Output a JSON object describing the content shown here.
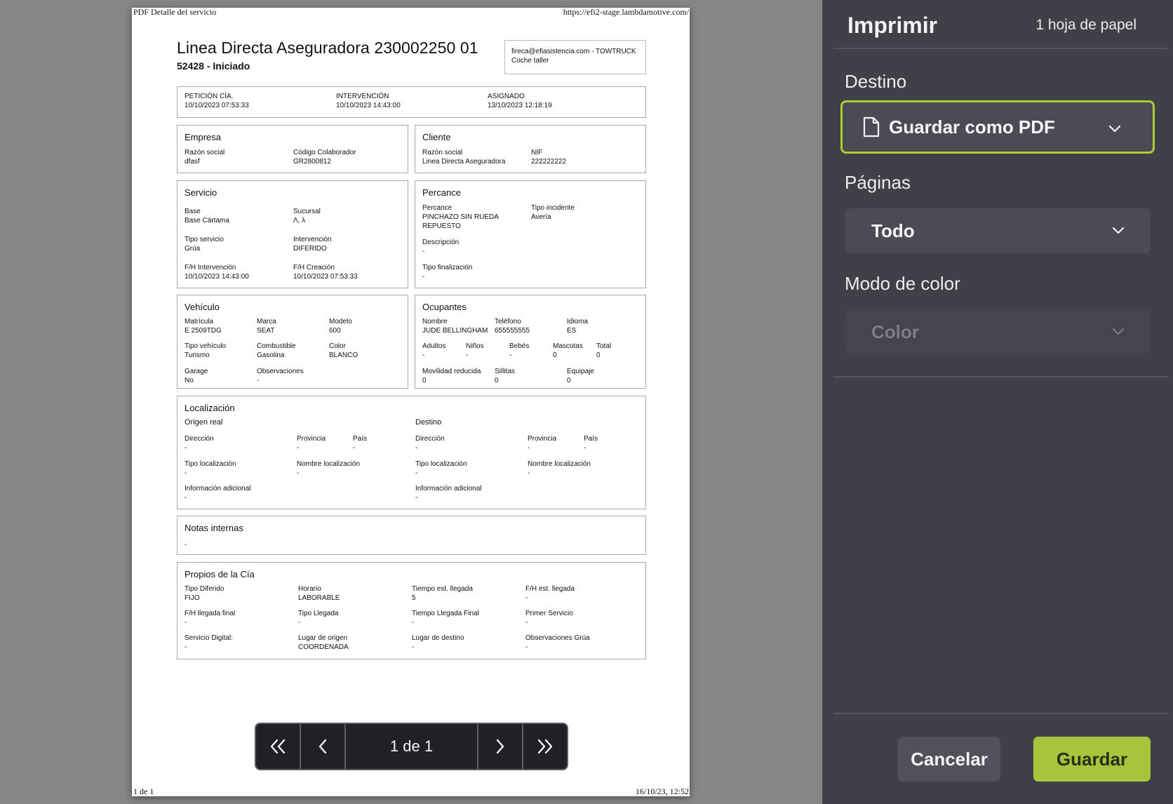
{
  "preview": {
    "page_header_left": "PDF Detalle del servicio",
    "page_header_right": "https://efi2-stage.lambdamotive.com/",
    "page_footer_left": "1 de 1",
    "page_footer_right": "16/10/23, 12:52",
    "doc_title": "Linea Directa Aseguradora 230002250 01",
    "doc_subtitle": "52428 - Iniciado",
    "contact_line1": "fireca@efiasistencia.com - TOWTRUCK",
    "contact_line2": "Coche taller",
    "timeline": [
      {
        "label": "PETICIÓN CÍA.",
        "value": "10/10/2023 07:53:33"
      },
      {
        "label": "INTERVENCIÓN",
        "value": "10/10/2023 14:43:00"
      },
      {
        "label": "ASIGNADO",
        "value": "13/10/2023 12:18:19"
      }
    ],
    "empresa": {
      "title": "Empresa",
      "fields": [
        {
          "label": "Razón social",
          "value": "dfasf"
        },
        {
          "label": "Código Colaborador",
          "value": "GR2800812"
        }
      ]
    },
    "cliente": {
      "title": "Cliente",
      "fields": [
        {
          "label": "Razón social",
          "value": "Linea Directa Aseguradora"
        },
        {
          "label": "NIF",
          "value": "222222222"
        }
      ]
    },
    "servicio": {
      "title": "Servicio",
      "fields": [
        {
          "label": "Base",
          "value": "Base Cártama"
        },
        {
          "label": "Sucursal",
          "value": "Λ, λ"
        },
        {
          "label": "Tipo servicio",
          "value": "Grúa"
        },
        {
          "label": "Intervención",
          "value": "DIFERIDO"
        },
        {
          "label": "F/H Intervención",
          "value": "10/10/2023 14:43:00"
        },
        {
          "label": "F/H Creación",
          "value": "10/10/2023 07:53:33"
        }
      ]
    },
    "percance": {
      "title": "Percance",
      "fields": [
        {
          "label": "Percance",
          "value": "PINCHAZO SIN RUEDA",
          "value2": "REPUESTO"
        },
        {
          "label": "Tipo incidente",
          "value": "Avería"
        },
        {
          "label": "Descripción",
          "value": "-"
        },
        {
          "label": "Tipo finalización",
          "value": "-"
        }
      ]
    },
    "vehiculo": {
      "title": "Vehículo",
      "fields": [
        {
          "label": "Matrícula",
          "value": "E 2509TDG"
        },
        {
          "label": "Marca",
          "value": "SEAT"
        },
        {
          "label": "Modelo",
          "value": "600"
        },
        {
          "label": "Tipo vehículo",
          "value": "Turismo"
        },
        {
          "label": "Combustible",
          "value": "Gasolina"
        },
        {
          "label": "Color",
          "value": "BLANCO"
        },
        {
          "label": "Garage",
          "value": "No"
        },
        {
          "label": "Observaciones",
          "value": "-"
        }
      ]
    },
    "ocupantes": {
      "title": "Ocupantes",
      "fields": [
        {
          "label": "Nombre",
          "value": "JUDE BELLINGHAM"
        },
        {
          "label": "Teléfono",
          "value": "655555555"
        },
        {
          "label": "Idioma",
          "value": "ES"
        },
        {
          "label": "Adultos",
          "value": "-"
        },
        {
          "label": "Niños",
          "value": "-"
        },
        {
          "label": "Bebés",
          "value": "-"
        },
        {
          "label": "Mascotas",
          "value": "0"
        },
        {
          "label": "Total",
          "value": "0"
        },
        {
          "label": "Movilidad reducida",
          "value": "0"
        },
        {
          "label": "Sillitas",
          "value": "0"
        },
        {
          "label": "Equipaje",
          "value": "0"
        }
      ]
    },
    "localizacion": {
      "title": "Localización",
      "origen_label": "Origen real",
      "destino_label": "Destino",
      "origen": [
        {
          "label": "Dirección",
          "value": "-"
        },
        {
          "label": "Provincia",
          "value": "-"
        },
        {
          "label": "País",
          "value": "-"
        },
        {
          "label": "Tipo localización",
          "value": "-"
        },
        {
          "label": "Nombre localización",
          "value": "-"
        },
        {
          "label": "Información adicional",
          "value": "-"
        }
      ],
      "destino": [
        {
          "label": "Dirección",
          "value": "-"
        },
        {
          "label": "Provincia",
          "value": "-"
        },
        {
          "label": "País",
          "value": "-"
        },
        {
          "label": "Tipo localización",
          "value": "-"
        },
        {
          "label": "Nombre localización",
          "value": "-"
        },
        {
          "label": "Información adicional",
          "value": "-"
        }
      ]
    },
    "notas": {
      "title": "Notas internas",
      "value": "-"
    },
    "propios": {
      "title": "Propios de la Cía",
      "fields": [
        {
          "label": "Tipo Diferido",
          "value": "FIJO"
        },
        {
          "label": "Horario",
          "value": "LABORABLE"
        },
        {
          "label": "Tiempo est. llegada",
          "value": "5"
        },
        {
          "label": "F/H est. llegada",
          "value": "-"
        },
        {
          "label": "F/H llegada final",
          "value": "-"
        },
        {
          "label": "Tipo Llegada",
          "value": "-"
        },
        {
          "label": "Tiempo Llegada Final",
          "value": "-"
        },
        {
          "label": "Primer Servicio",
          "value": "-"
        },
        {
          "label": "Servicio Digital:",
          "value": "-"
        },
        {
          "label": "Lugar de origen",
          "value": "COORDENADA"
        },
        {
          "label": "Lugar de destino",
          "value": "-"
        },
        {
          "label": "Observaciones Grúa",
          "value": "-"
        }
      ]
    }
  },
  "pager": {
    "first_glyph": "«",
    "prev_glyph": "‹",
    "page_text": "1 de 1",
    "next_glyph": "›",
    "last_glyph": "»"
  },
  "panel": {
    "title": "Imprimir",
    "sheets": "1 hoja de papel",
    "destino_label": "Destino",
    "destino_value": "Guardar como PDF",
    "destino_icon": "document-icon",
    "paginas_label": "Páginas",
    "paginas_value": "Todo",
    "color_label": "Modo de color",
    "color_value": "Color",
    "cancel_label": "Cancelar",
    "save_label": "Guardar",
    "accent_color": "#a7c43a"
  }
}
